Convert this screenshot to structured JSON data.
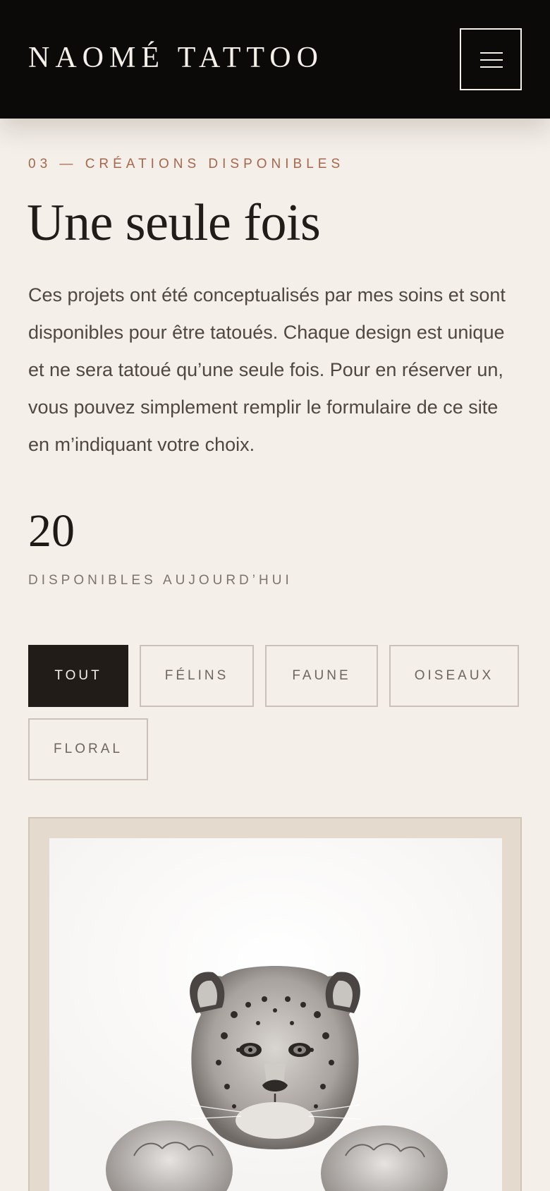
{
  "header": {
    "brand": "NAOMÉ TATTOO",
    "menu_icon": "hamburger-menu-icon"
  },
  "intro": {
    "eyebrow": "03 — CRÉATIONS DISPONIBLES",
    "title": "Une seule fois",
    "description": "Ces projets ont été conceptualisés par mes soins et sont disponibles pour être tatoués. Chaque design est unique et ne sera tatoué qu’une seule fois. Pour en réserver un, vous pouvez simplement remplir le formulaire de ce site en m’indiquant votre choix."
  },
  "stats": {
    "count": "20",
    "label": "DISPONIBLES AUJOURD’HUI"
  },
  "filters": [
    {
      "label": "TOUT",
      "active": true
    },
    {
      "label": "FÉLINS",
      "active": false
    },
    {
      "label": "FAUNE",
      "active": false
    },
    {
      "label": "OISEAUX",
      "active": false
    },
    {
      "label": "FLORAL",
      "active": false
    }
  ],
  "colors": {
    "background": "#f4efe9",
    "header": "#0b0a09",
    "accent": "#a5684e",
    "active_filter": "#221c18",
    "card_frame": "#e4dace"
  },
  "gallery": {
    "first_card_image": "leopard-illustration"
  }
}
